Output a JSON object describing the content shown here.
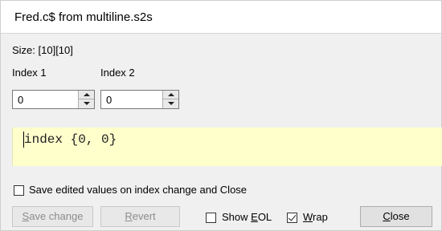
{
  "window": {
    "title": "Fred.c$ from multiline.s2s"
  },
  "size": {
    "label": "Size: [10][10]"
  },
  "index1": {
    "label": "Index 1",
    "value": "0"
  },
  "index2": {
    "label": "Index 2",
    "value": "0"
  },
  "editor": {
    "text": "index {0, 0}",
    "background": "#ffffcc"
  },
  "save_edited": {
    "label": "Save edited values on index change and Close",
    "checked": false
  },
  "buttons": {
    "save_change": {
      "label_mnemonic": "S",
      "label_rest": "ave change",
      "enabled": false
    },
    "revert": {
      "label_mnemonic": "R",
      "label_rest": "evert",
      "enabled": false
    },
    "close": {
      "label_mnemonic": "C",
      "label_rest": "lose",
      "enabled": true
    }
  },
  "show_eol": {
    "label_pre": "Show ",
    "label_mnemonic": "E",
    "label_rest": "OL",
    "checked": false
  },
  "wrap": {
    "label_mnemonic": "W",
    "label_rest": "rap",
    "checked": true
  },
  "icons": [
    "spin-up-icon",
    "spin-down-icon",
    "checkmark-icon"
  ]
}
